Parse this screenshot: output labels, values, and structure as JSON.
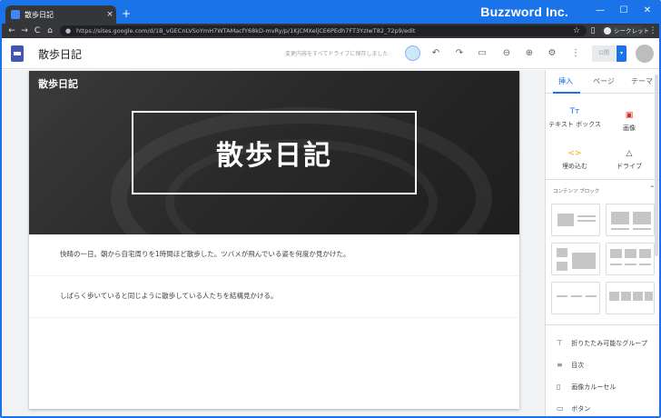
{
  "browser": {
    "tab_title": "散歩日記",
    "tab_close": "×",
    "new_tab": "+",
    "url": "https://sites.google.com/d/1B_vGECnLVSoYmH7WTAMacfY68kD-mvRy/p/1KjCMXeljCE6PEdh7FT3YzIwT82_72p9/edit",
    "incognito_label": "シークレット",
    "brand": "Buzzword Inc.",
    "min": "—",
    "max": "☐",
    "close": "✕",
    "back": "←",
    "forward": "→",
    "reload": "C",
    "home": "⌂",
    "star": "☆",
    "menu": "⋮"
  },
  "header": {
    "site_name": "散歩日記",
    "save_status": "変更内容をすべてドライブに保存しました",
    "undo": "↶",
    "redo": "↷",
    "preview": "▭",
    "link": "⊖",
    "share": "⊕",
    "settings": "⚙",
    "more": "⋮",
    "publish": "公開",
    "publish_drop": "▾"
  },
  "page": {
    "site_label": "散歩日記",
    "hero_title": "散歩日記",
    "paragraphs": [
      "快晴の一日。朝から自宅周りを1時間ほど散歩した。ツバメが飛んでいる姿を何度か見かけた。",
      "しばらく歩いていると同じように散歩している人たちを結構見かける。"
    ]
  },
  "panel": {
    "tabs": [
      "挿入",
      "ページ",
      "テーマ"
    ],
    "tools": [
      {
        "icon": "Tт",
        "label": "テキスト ボックス"
      },
      {
        "icon": "▣",
        "label": "画像"
      },
      {
        "icon": "<>",
        "label": "埋め込む"
      },
      {
        "icon": "△",
        "label": "ドライブ"
      }
    ],
    "content_blocks_label": "コンテンツ ブロック",
    "collapse": "⌃",
    "list": [
      {
        "icon": "⊤",
        "label": "折りたたみ可能なグループ"
      },
      {
        "icon": "≡",
        "label": "目次"
      },
      {
        "icon": "▯",
        "label": "画像カルーセル"
      },
      {
        "icon": "▭",
        "label": "ボタン"
      }
    ]
  },
  "colors": {
    "accent": "#1a73e8",
    "hero_bg": "#2a2a2a",
    "doc_icon": "#4356b0"
  }
}
